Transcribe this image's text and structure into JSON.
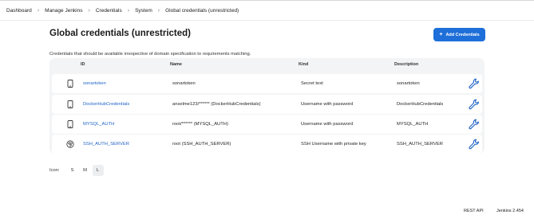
{
  "breadcrumb": {
    "items": [
      "Dashboard",
      "Manage Jenkins",
      "Credentials",
      "System",
      "Global credentials (unrestricted)"
    ],
    "separator": "›"
  },
  "page": {
    "title": "Global credentials (unrestricted)",
    "subtitle": "Credentials that should be available irrespective of domain specification to requirements matching.",
    "add_button": "Add Credentials"
  },
  "table": {
    "headers": {
      "id": "ID",
      "name": "Name",
      "kind": "Kind",
      "description": "Description"
    },
    "rows": [
      {
        "icon": "phone-icon",
        "id": "sonartoken",
        "name": "sonartoken",
        "kind": "Secret text",
        "description": "sonartoken"
      },
      {
        "icon": "phone-icon",
        "id": "DockerHubCredentials",
        "name": "anselme123/****** (DockerHubCredentials)",
        "kind": "Username with password",
        "description": "DockerHubCredentials"
      },
      {
        "icon": "phone-icon",
        "id": "MYSQL_AUTH",
        "name": "root/****** (MYSQL_AUTH)",
        "kind": "Username with password",
        "description": "MYSQL_AUTH"
      },
      {
        "icon": "fingerprint-icon",
        "id": "SSH_AUTH_SERVER",
        "name": "root (SSH_AUTH_SERVER)",
        "kind": "SSH Username with private key",
        "description": "SSH_AUTH_SERVER"
      }
    ]
  },
  "icon_size": {
    "label": "Icon:",
    "options": [
      "S",
      "M",
      "L"
    ],
    "selected": "L"
  },
  "footer": {
    "rest_api": "REST API",
    "version": "Jenkins 2.454"
  },
  "colors": {
    "accent": "#1e6fd9",
    "link": "#1f63c6",
    "table_bg": "#f3f4f5"
  }
}
